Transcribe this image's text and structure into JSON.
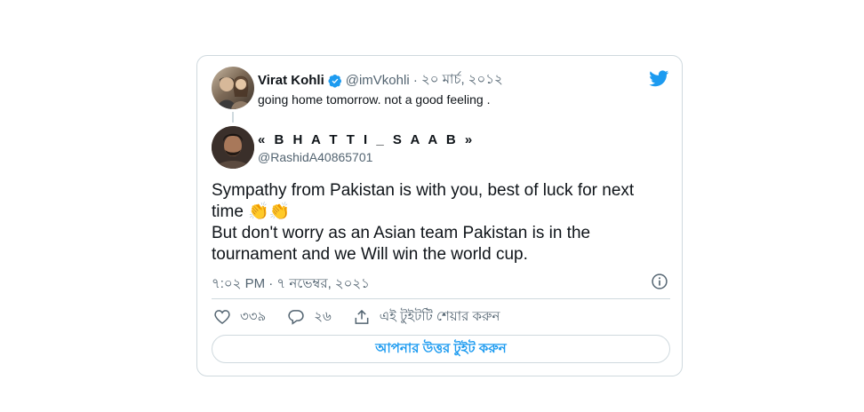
{
  "parent_tweet": {
    "name": "Virat Kohli",
    "handle": "@imVkohli",
    "separator": " · ",
    "date": "২০ মার্চ, ২০১২",
    "text": "going home tomorrow. not a good feeling ."
  },
  "reply_tweet": {
    "name": "« B H A T T I _ S A A B »",
    "handle": "@RashidA40865701",
    "body_line1": "Sympathy from Pakistan is with you, best of luck for next",
    "body_line2": "time",
    "body_emoji": "👏👏",
    "body_line3": "But don't worry as an Asian team Pakistan is in the",
    "body_line4": "tournament and we Will win the world cup.",
    "timestamp": "৭:০২ PM · ৭ নভেম্বর, ২০২১"
  },
  "actions": {
    "like_count": "৩৩৯",
    "reply_count": "২৬",
    "share_label": "এই টুইটটি শেয়ার করুন"
  },
  "reply_button_label": "আপনার উত্তর টুইট করুন",
  "colors": {
    "accent": "#1d9bf0",
    "muted": "#536471",
    "border": "#cfd9de"
  },
  "icons": {
    "brand": "twitter-bird-icon",
    "verified": "verified-badge-icon",
    "info": "info-icon",
    "like": "heart-icon",
    "reply": "comment-icon",
    "share": "share-icon"
  }
}
